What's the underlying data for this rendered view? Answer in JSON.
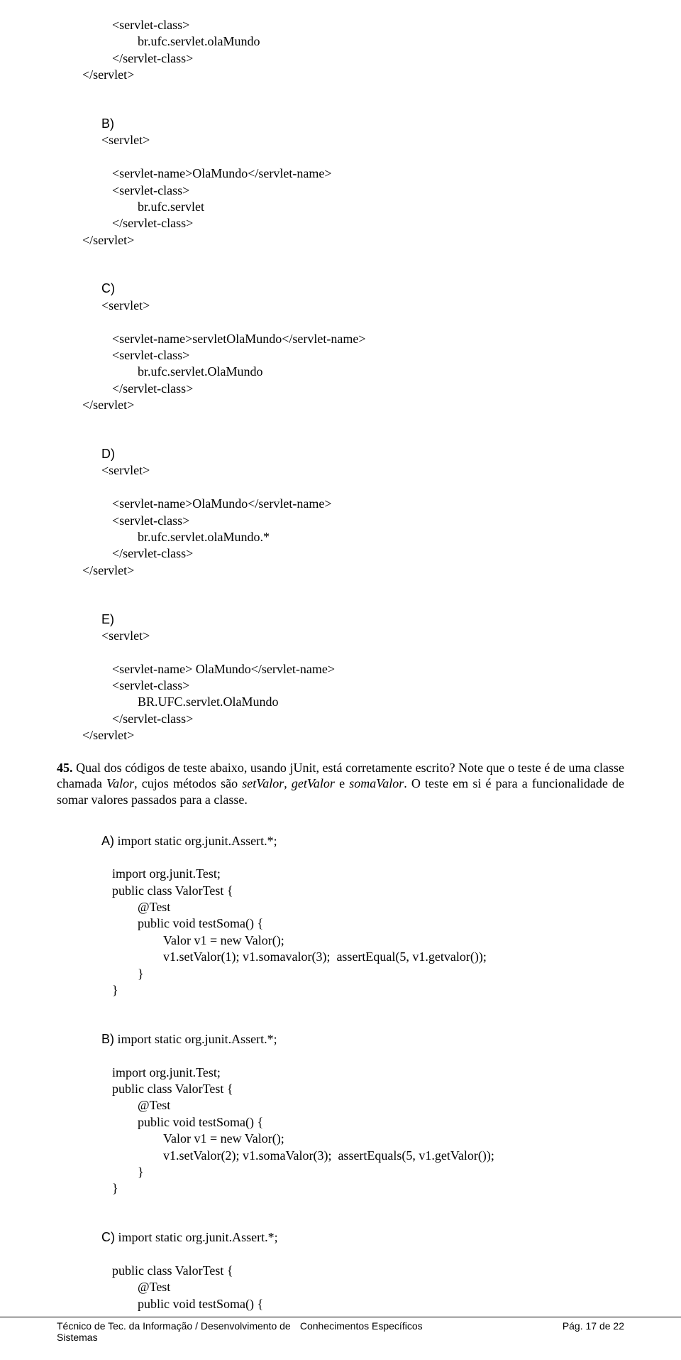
{
  "code_top": {
    "l1": "<servlet-class>",
    "l2": "br.ufc.servlet.olaMundo",
    "l3": "</servlet-class>",
    "l4": "</servlet>"
  },
  "optB": {
    "label": "B)",
    "l1": "<servlet>",
    "l2": "<servlet-name>OlaMundo</servlet-name>",
    "l3": "<servlet-class>",
    "l4": "br.ufc.servlet",
    "l5": "</servlet-class>",
    "l6": "</servlet>"
  },
  "optC": {
    "label": "C)",
    "l1": "<servlet>",
    "l2": "<servlet-name>servletOlaMundo</servlet-name>",
    "l3": "<servlet-class>",
    "l4": "br.ufc.servlet.OlaMundo",
    "l5": "</servlet-class>",
    "l6": "</servlet>"
  },
  "optD": {
    "label": "D)",
    "l1": "<servlet>",
    "l2": "<servlet-name>OlaMundo</servlet-name>",
    "l3": "<servlet-class>",
    "l4": "br.ufc.servlet.olaMundo.*",
    "l5": "</servlet-class>",
    "l6": "</servlet>"
  },
  "optE": {
    "label": "E)",
    "l1": "<servlet>",
    "l2": "<servlet-name> OlaMundo</servlet-name>",
    "l3": "<servlet-class>",
    "l4": "BR.UFC.servlet.OlaMundo",
    "l5": "</servlet-class>",
    "l6": "</servlet>"
  },
  "q45": {
    "num": "45.",
    "t1": " Qual dos códigos de teste abaixo, usando jUnit, está corretamente escrito? Note que o teste é de uma classe chamada ",
    "i1": "Valor",
    "t2": ", cujos métodos são ",
    "i2": "setValor",
    "t3": ", ",
    "i3": "getValor",
    "t4": " e ",
    "i4": "somaValor",
    "t5": ". O teste em si é para a funcionalidade de somar valores passados para a classe."
  },
  "aA": {
    "label": "A)",
    "l1": " import static org.junit.Assert.*;",
    "l2": "import org.junit.Test;",
    "l3": "public class ValorTest {",
    "l4": "@Test",
    "l5": "public void testSoma() {",
    "l6": "Valor v1 = new Valor();",
    "l7": "v1.setValor(1); v1.somavalor(3);  assertEqual(5, v1.getvalor());",
    "l8": "}",
    "l9": "}"
  },
  "aB": {
    "label": "B)",
    "l1": " import static org.junit.Assert.*;",
    "l2": "import org.junit.Test;",
    "l3": "public class ValorTest {",
    "l4": "@Test",
    "l5": "public void testSoma() {",
    "l6": "Valor v1 = new Valor();",
    "l7": "v1.setValor(2); v1.somaValor(3);  assertEquals(5, v1.getValor());",
    "l8": "}",
    "l9": "}"
  },
  "aC": {
    "label": "C)",
    "l1": " import static org.junit.Assert.*;",
    "l2": "public class ValorTest {",
    "l3": "@Test",
    "l4": "public void testSoma() {"
  },
  "footer": {
    "left1": "Técnico de Tec. da Informação / Desenvolvimento de",
    "left2": "Sistemas",
    "center": "Conhecimentos Específicos",
    "right": "Pág. 17 de 22"
  }
}
